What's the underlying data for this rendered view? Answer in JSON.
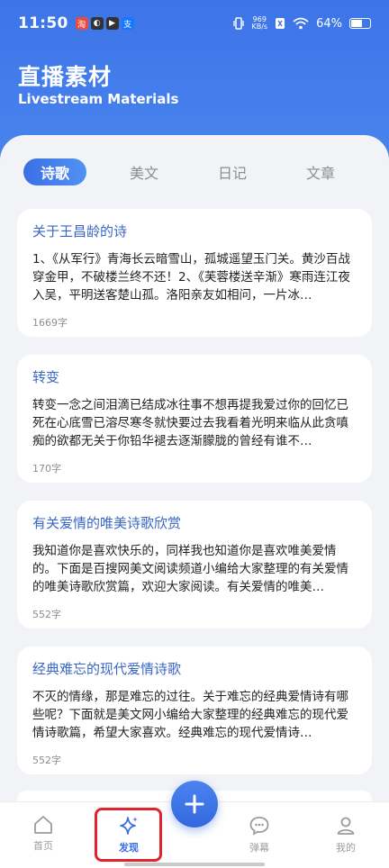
{
  "status_bar": {
    "time": "11:50",
    "app_icons": [
      {
        "name": "red-app-icon",
        "glyph": "淘",
        "color": "#e84c3d"
      },
      {
        "name": "black-app-icon",
        "glyph": "◐",
        "color": "#333333"
      },
      {
        "name": "play-app-icon",
        "glyph": "▶",
        "color": "#333333"
      },
      {
        "name": "alipay-app-icon",
        "glyph": "支",
        "color": "#1677ff"
      }
    ],
    "net_speed_value": "969",
    "net_speed_unit": "KB/s",
    "battery": "64%",
    "battery_level": 0.64
  },
  "header": {
    "title": "直播素材",
    "subtitle": "Livestream Materials"
  },
  "tabs": [
    "诗歌",
    "美文",
    "日记",
    "文章"
  ],
  "active_tab": 0,
  "cards": [
    {
      "title": "关于王昌龄的诗",
      "text": "1、《从军行》青海长云暗雪山，孤城遥望玉门关。黄沙百战穿金甲，不破楼兰终不还！2、《芙蓉楼送辛渐》寒雨连江夜入吴，平明送客楚山孤。洛阳亲友如相问，一片冰…",
      "count": "1669字"
    },
    {
      "title": "转变",
      "text": "转变一念之间泪滴已结成冰往事不想再提我爱过你的回忆已死在心底雪已溶尽寒冬就快要过去我看着光明来临从此贪嗔痴的欲都无关于你铅华褪去逐渐朦胧的曾经有谁不…",
      "count": "170字"
    },
    {
      "title": "有关爱情的唯美诗歌欣赏",
      "text": "我知道你是喜欢快乐的，同样我也知道你是喜欢唯美爱情的。下面是百搜网美文阅读频道小编给大家整理的有关爱情的唯美诗歌欣赏篇，欢迎大家阅读。有关爱情的唯美…",
      "count": "552字"
    },
    {
      "title": "经典难忘的现代爱情诗歌",
      "text": "不灭的情缘，那是难忘的过往。关于难忘的经典爱情诗有哪些呢？下面就是美文网小编给大家整理的经典难忘的现代爱情诗歌篇，希望大家喜欢。经典难忘的现代爱情诗…",
      "count": "552字"
    }
  ],
  "bottom_nav": {
    "home": "首页",
    "discover": "发现",
    "danmaku": "弹幕",
    "mine": "我的"
  },
  "colors": {
    "accent": "#3b6fe6",
    "title_blue": "#3a66c4",
    "highlight": "#e0242f"
  }
}
